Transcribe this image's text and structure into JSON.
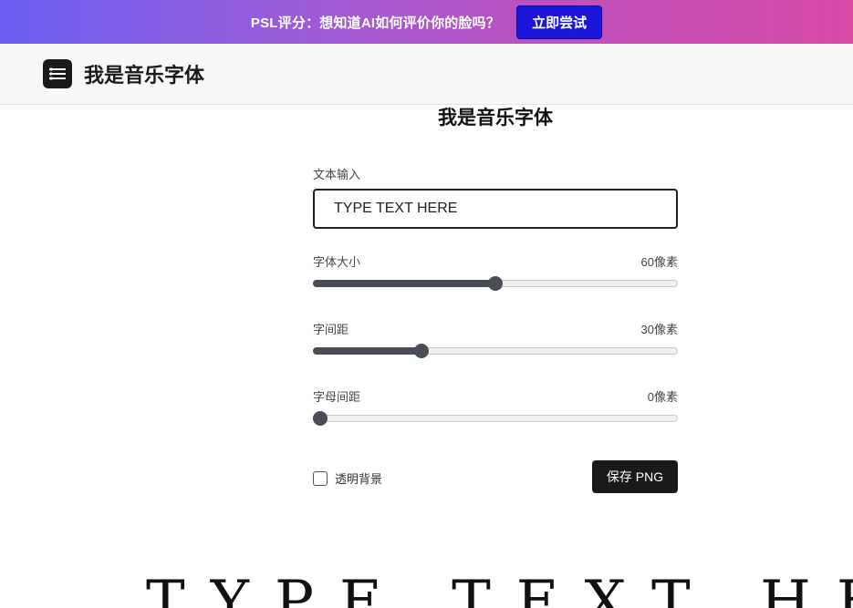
{
  "promo": {
    "text": "PSL评分：想知道AI如何评价你的脸吗？",
    "button_label": "立即尝试"
  },
  "header": {
    "logo_icon": "menu-lines-icon",
    "site_title": "我是音乐字体"
  },
  "tool": {
    "title": "我是音乐字体",
    "text_input": {
      "label": "文本输入",
      "value": "TYPE TEXT HERE"
    },
    "sliders": [
      {
        "label": "字体大小",
        "value_text": "60像素",
        "fraction": 0.5
      },
      {
        "label": "字间距",
        "value_text": "30像素",
        "fraction": 0.29
      },
      {
        "label": "字母间距",
        "value_text": "0像素",
        "fraction": 0.0
      }
    ],
    "transparent_bg": {
      "label": "透明背景",
      "checked": false
    },
    "save_button_label": "保存 PNG"
  },
  "preview": {
    "text": "TYPE TEXT HERE"
  },
  "colors": {
    "promo_gradient_start": "#6a5ff0",
    "promo_gradient_end": "#d84aa6",
    "promo_button": "#1c17d8",
    "slider_fill": "#494d55",
    "dark_button": "#1a1a1a"
  }
}
